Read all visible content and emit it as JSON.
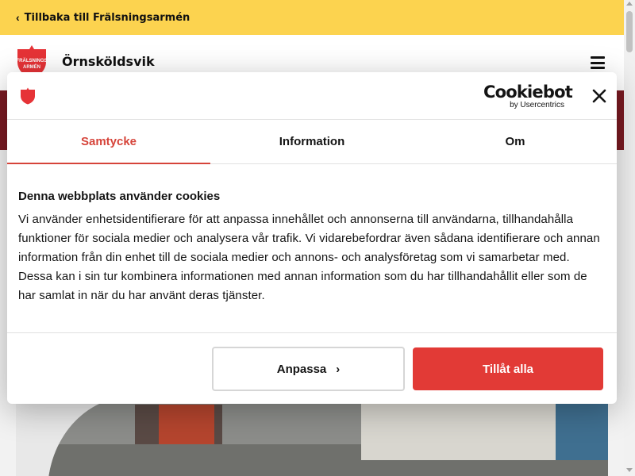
{
  "topbar": {
    "back_label": "Tillbaka till Frälsningsarmén",
    "background": "#fcd34f"
  },
  "header": {
    "site_title": "Örnsköldsvik",
    "logo_text": [
      "FRÄLSNINGS",
      "ARMÉN"
    ],
    "logo_color": "#e63337",
    "menu_icon": "hamburger-menu-icon"
  },
  "cookie_dialog": {
    "brand_name": "Cookiebot",
    "brand_sub": "by Usercentrics",
    "close_icon": "close-icon",
    "tabs": [
      {
        "label": "Samtycke",
        "active": true
      },
      {
        "label": "Information",
        "active": false
      },
      {
        "label": "Om",
        "active": false
      }
    ],
    "title": "Denna webbplats använder cookies",
    "body": "Vi använder enhetsidentifierare för att anpassa innehållet och annonserna till användarna, tillhandahålla funktioner för sociala medier och analysera vår trafik. Vi vidarebefordrar även sådana identifierare och annan information från din enhet till de sociala medier och annons- och analysföretag som vi samarbetar med. Dessa kan i sin tur kombinera informationen med annan information som du har tillhandahållit eller som de har samlat in när du har använt deras tjänster.",
    "customize_label": "Anpassa",
    "allow_all_label": "Tillåt alla",
    "accent_color": "#d6443a",
    "allow_color": "#e23a36"
  }
}
